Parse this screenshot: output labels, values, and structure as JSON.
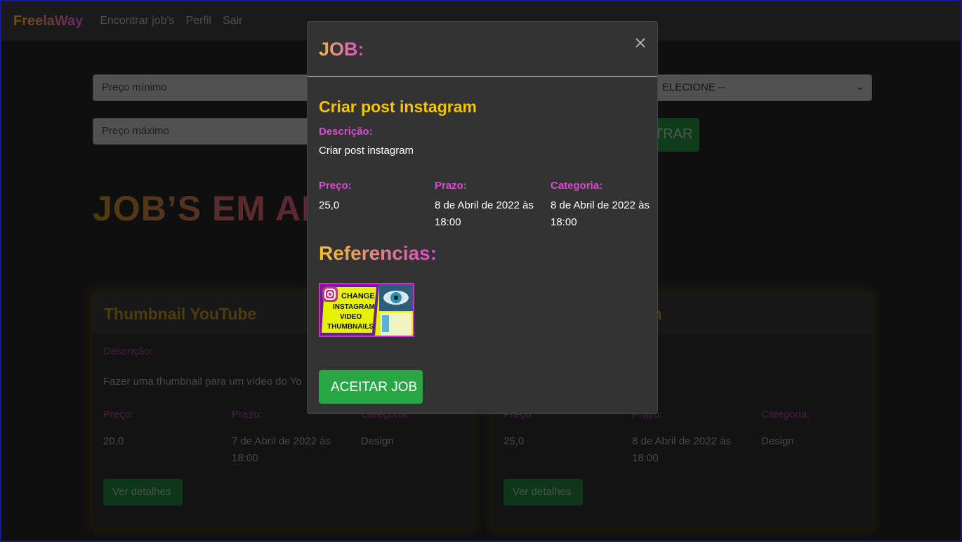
{
  "navbar": {
    "brand": "FreelaWay",
    "links": [
      "Encontrar job's",
      "Perfil",
      "Sair"
    ]
  },
  "filters": {
    "min_price_placeholder": "Preço mínimo",
    "max_price_placeholder": "Preço máximo",
    "category_select_value": "ELECIONE --",
    "filter_button": "TRAR"
  },
  "section_title": "JOB’S EM AB",
  "cards": [
    {
      "title": "Thumbnail YouTube",
      "desc_label": "Descrição:",
      "desc": "Fazer uma thumbnail para um vídeo do Yo",
      "price_label": "Preço:",
      "price": "20,0",
      "deadline_label": "Prazo:",
      "deadline": "7 de Abril de 2022 às 18:00",
      "category_label": "Categoria:",
      "category": "Design",
      "button": "Ver detalhes"
    },
    {
      "title": "m",
      "price_label": "Preço:",
      "price": "25,0",
      "deadline_label": "Prazo:",
      "deadline": "8 de Abril de 2022 às 18:00",
      "category_label": "Categoria:",
      "category": "Design",
      "button": "Ver detalhes"
    }
  ],
  "modal": {
    "title": "JOB:",
    "job_name": "Criar post instagram",
    "desc_label": "Descrição:",
    "desc": "Criar post instagram",
    "price_label": "Preço:",
    "price": "25,0",
    "deadline_label": "Prazo:",
    "deadline": "8 de Abril de 2022 às 18:00",
    "category_label": "Categoria:",
    "category": "8 de Abril de 2022 às 18:00",
    "references_title": "Referencias:",
    "reference_image_text": [
      "CHANGE",
      "INSTAGRAM",
      "VIDEO",
      "THUMBNAILS"
    ],
    "accept_button": "ACEITAR JOB"
  },
  "colors": {
    "accent_green": "#28a745",
    "label_pink": "#d84ad0",
    "job_yellow": "#f2c500",
    "modal_bg": "#333333"
  }
}
